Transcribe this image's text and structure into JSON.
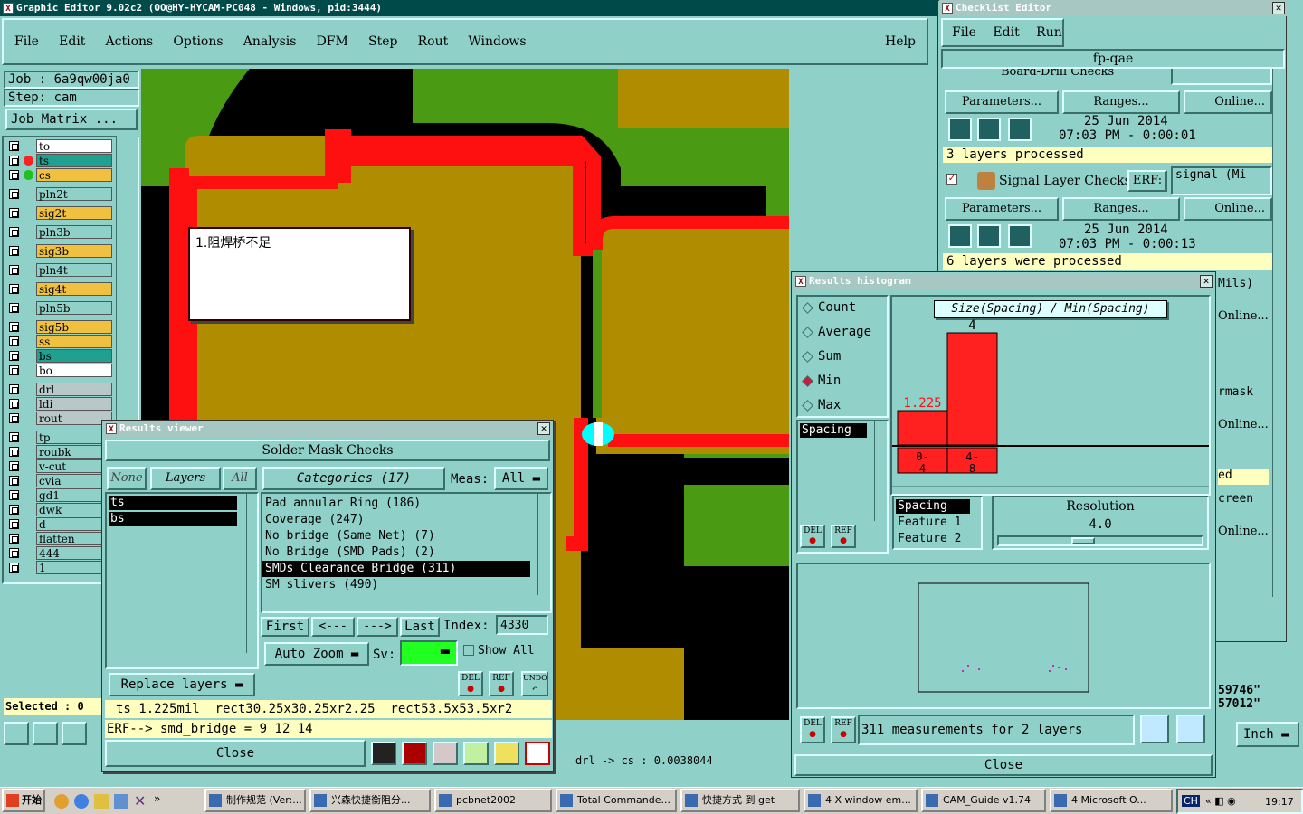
{
  "main_window": {
    "title": "Graphic Editor 9.02c2 (OO@HY-HYCAM-PC048 - Windows, pid:3444)",
    "menu": [
      "File",
      "Edit",
      "Actions",
      "Options",
      "Analysis",
      "DFM",
      "Step",
      "Rout",
      "Windows"
    ],
    "help": "Help",
    "job": "Job : 6a9qw00ja0",
    "step": "Step: cam",
    "job_matrix": "Job Matrix ...",
    "layers": [
      "to",
      "ts",
      "cs",
      "pln2t",
      "sig2t",
      "pln3b",
      "sig3b",
      "pln4t",
      "sig4t",
      "pln5b",
      "sig5b",
      "ss",
      "bs",
      "bo",
      "drl",
      "ldi",
      "rout",
      "tp",
      "roubk",
      "v-cut",
      "cvia",
      "gd1",
      "dwk",
      "d",
      "flatten",
      "444",
      "1"
    ],
    "selected": "Selected : 0",
    "status_drl": "drl -> cs : 0.0038044",
    "annotation": "1.阻焊桥不足",
    "units": "Inch"
  },
  "checklist": {
    "title": "Checklist Editor",
    "menu": [
      "File",
      "Edit",
      "Run"
    ],
    "name": "fp-qae",
    "partial_check": "Board-Drill Checks",
    "erf_label": "ERF:",
    "parameters": "Parameters...",
    "ranges": "Ranges...",
    "online": "Online...",
    "check1_date": "25 Jun 2014",
    "check1_time": "07:03 PM - 0:00:01",
    "check1_status": "3 layers processed",
    "check2_name": "Signal Layer Checks",
    "check2_erf": "signal (Mi",
    "check2_date": "25 Jun 2014",
    "check2_time": "07:03 PM - 0:00:13",
    "check2_status": "6 layers were processed",
    "right_fragments": [
      "Mils)",
      "Online...",
      "rmask",
      "Online...",
      "ed",
      "creen",
      "Online...",
      "59746\"",
      "57012\""
    ]
  },
  "results_viewer": {
    "title": "Results viewer",
    "heading": "Solder Mask Checks",
    "none": "None",
    "layers_btn": "Layers",
    "all": "All",
    "categories": "Categories (17)",
    "meas_label": "Meas:",
    "meas_value": "All",
    "layer_list": [
      "ts",
      "bs"
    ],
    "category_list": [
      "Pad annular Ring (186)",
      "Coverage (247)",
      "No bridge (Same Net) (7)",
      "No Bridge (SMD Pads) (2)",
      "SMDs Clearance Bridge (311)",
      "SM slivers (490)"
    ],
    "selected_category": "SMDs Clearance Bridge (311)",
    "first": "First",
    "prev": "<---",
    "next": "--->",
    "last": "Last",
    "index_label": "Index:",
    "index_value": "4330",
    "auto_zoom": "Auto Zoom",
    "sv_label": "Sv:",
    "show_all": "Show All",
    "replace_layers": "Replace layers",
    "del": "DEL",
    "ref": "REF",
    "undo": "UNDO",
    "info_line": "ts 1.225mil  rect30.25x30.25xr2.25  rect53.5x53.5xr2",
    "erf_line": "ERF--> smd_bridge = 9 12 14",
    "close": "Close"
  },
  "histogram": {
    "title": "Results histogram",
    "options": [
      "Count",
      "Average",
      "Sum",
      "Min",
      "Max"
    ],
    "selected_option": "Min",
    "list_item": "Spacing",
    "chart_title": "Size(Spacing) / Min(Spacing)",
    "bar_labels": [
      "1.225",
      "4"
    ],
    "bin_labels": [
      [
        "0-",
        "4"
      ],
      [
        "4-",
        "8"
      ]
    ],
    "fields": [
      "Spacing",
      "Feature 1",
      "Feature 2"
    ],
    "resolution_label": "Resolution",
    "resolution_value": "4.0",
    "summary": "311 measurements for 2 layers",
    "del": "DEL",
    "ref": "REF",
    "close": "Close"
  },
  "chart_data": {
    "type": "bar",
    "title": "Size(Spacing) / Min(Spacing)",
    "categories": [
      "0-4",
      "4-8"
    ],
    "values": [
      1.225,
      4
    ]
  },
  "taskbar": {
    "start": "开始",
    "tasks": [
      "制作规范 (Ver:...",
      "兴森快捷衡阻分...",
      "pcbnet2002",
      "Total Commande...",
      "快捷方式 到 get",
      "4 X window em...",
      "CAM_Guide v1.74",
      "4 Microsoft O..."
    ],
    "lang": "CH",
    "clock": "19:17"
  },
  "colors": {
    "teal": "#8fd0c8",
    "green": "#4a9a14",
    "gold": "#b08c00",
    "red": "#ff1010",
    "black": "#000000"
  }
}
